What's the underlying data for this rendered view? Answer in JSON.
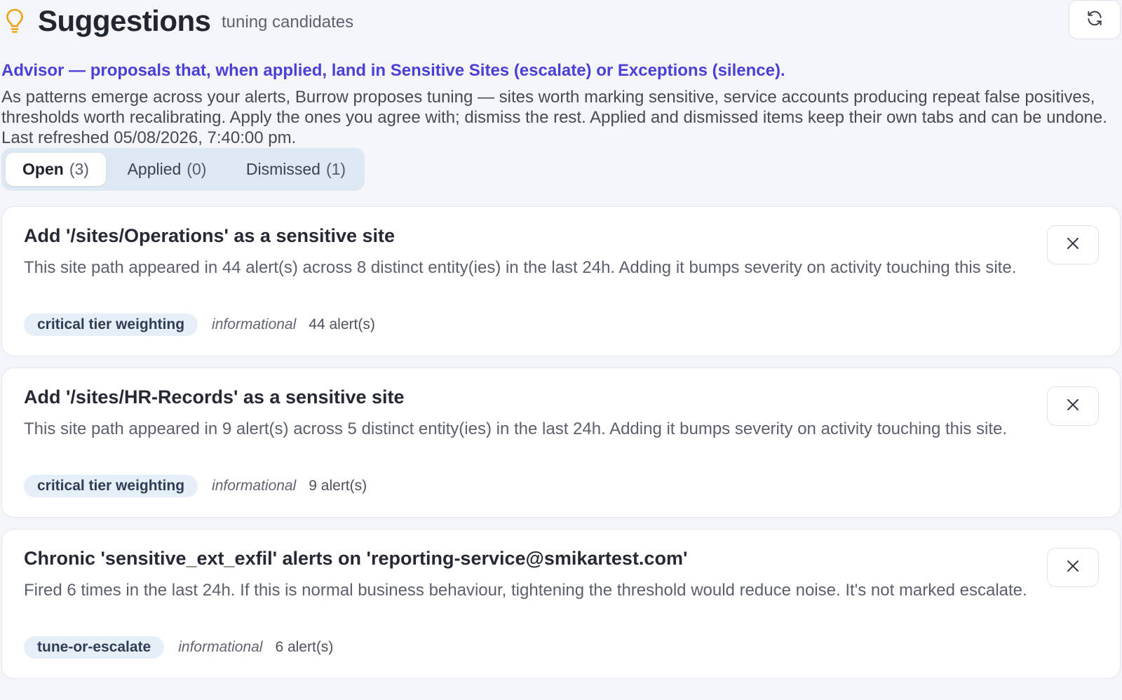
{
  "header": {
    "icon": "lightbulb-icon",
    "title": "Suggestions",
    "subtitle": "tuning candidates",
    "refresh_icon": "refresh-icon"
  },
  "advisor": {
    "heading": "Advisor — proposals that, when applied, land in Sensitive Sites (escalate) or Exceptions (silence).",
    "description": "As patterns emerge across your alerts, Burrow proposes tuning — sites worth marking sensitive, service accounts producing repeat false positives, thresholds worth recalibrating. Apply the ones you agree with; dismiss the rest. Applied and dismissed items keep their own tabs and can be undone. Last refreshed 05/08/2026, 7:40:00 pm."
  },
  "tabs": [
    {
      "label": "Open",
      "count": "(3)",
      "active": true
    },
    {
      "label": "Applied",
      "count": "(0)",
      "active": false
    },
    {
      "label": "Dismissed",
      "count": "(1)",
      "active": false
    }
  ],
  "suggestions": [
    {
      "title": "Add '/sites/Operations' as a sensitive site",
      "body": "This site path appeared in 44 alert(s) across 8 distinct entity(ies) in the last 24h. Adding it bumps severity on activity touching this site.",
      "tag": "critical tier weighting",
      "severity": "informational",
      "alerts": "44 alert(s)"
    },
    {
      "title": "Add '/sites/HR-Records' as a sensitive site",
      "body": "This site path appeared in 9 alert(s) across 5 distinct entity(ies) in the last 24h. Adding it bumps severity on activity touching this site.",
      "tag": "critical tier weighting",
      "severity": "informational",
      "alerts": "9 alert(s)"
    },
    {
      "title": "Chronic 'sensitive_ext_exfil' alerts on 'reporting-service@smikartest.com'",
      "body": "Fired 6 times in the last 24h. If this is normal business behaviour, tightening the threshold would reduce noise. It's not marked escalate.",
      "tag": "tune-or-escalate",
      "severity": "informational",
      "alerts": "6 alert(s)"
    }
  ],
  "colors": {
    "accent": "#4b3fd8",
    "bulb": "#f0a010",
    "background": "#f4f5f9",
    "tab_strip": "#dde8f3",
    "tag_bg": "#e6eff7"
  }
}
